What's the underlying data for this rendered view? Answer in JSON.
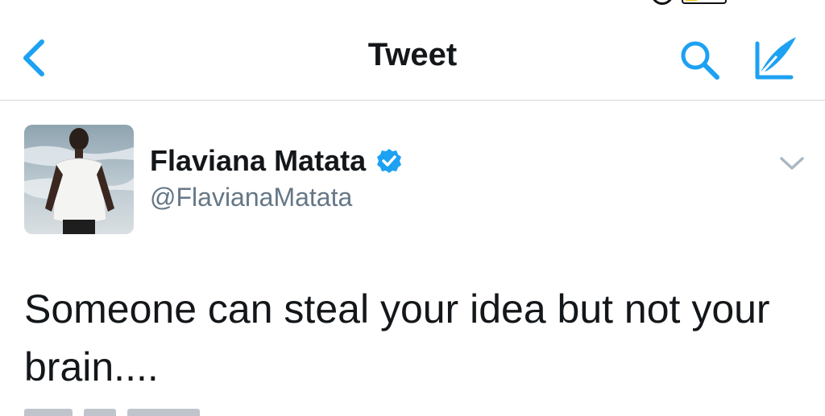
{
  "nav": {
    "title": "Tweet",
    "back_icon": "chevron-left-icon",
    "search_icon": "search-icon",
    "compose_icon": "compose-icon"
  },
  "tweet": {
    "author_name": "Flaviana Matata",
    "handle": "@FlavianaMatata",
    "verified": true,
    "text": "Someone can steal your idea but not your brain...."
  },
  "colors": {
    "accent": "#1da1f2",
    "text": "#14171a",
    "secondary_text": "#657786",
    "divider": "#d8d8d8",
    "verified": "#1da1f2"
  }
}
